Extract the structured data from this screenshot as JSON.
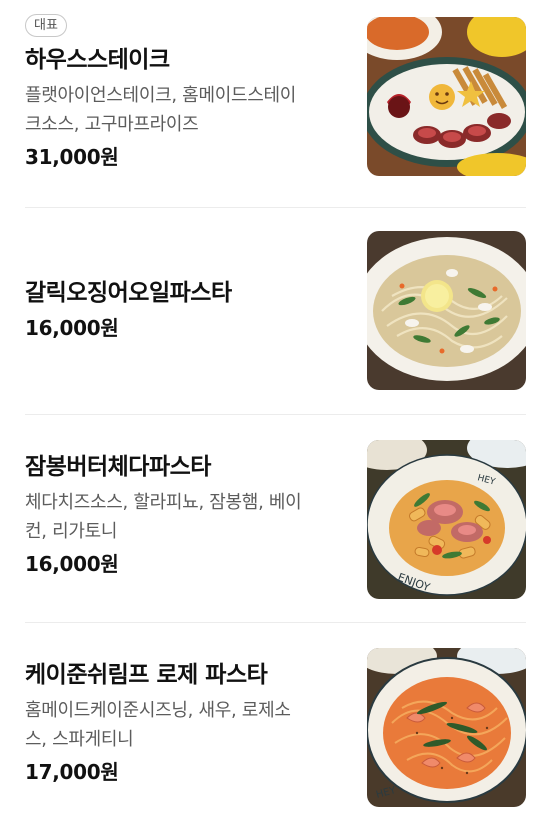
{
  "menu": {
    "items": [
      {
        "badge": "대표",
        "name": "하우스스테이크",
        "desc_line1": "플랫아이언스테이크, 홈메이드스테이",
        "desc_line2": "크소스, 고구마프라이즈",
        "price": "31,000원",
        "image_icon": "steak-plate-photo"
      },
      {
        "name": "갈릭오징어오일파스타",
        "price": "16,000원",
        "image_icon": "garlic-squid-pasta-photo"
      },
      {
        "name": "잠봉버터체다파스타",
        "desc_line1": "체다치즈소스, 할라피뇨, 잠봉햄, 베이",
        "desc_line2": "컨, 리가토니",
        "price": "16,000원",
        "image_icon": "jambon-cheddar-pasta-photo"
      },
      {
        "name": "케이준쉬림프 로제 파스타",
        "desc_line1": "홈메이드케이준시즈닝, 새우, 로제소",
        "desc_line2": "스, 스파게티니",
        "price": "17,000원",
        "image_icon": "cajun-shrimp-rose-pasta-photo"
      }
    ]
  },
  "colors": {
    "text_primary": "#111111",
    "text_secondary": "#5c5c5c",
    "divider": "#ececec",
    "badge_border": "#c8c8c8"
  }
}
